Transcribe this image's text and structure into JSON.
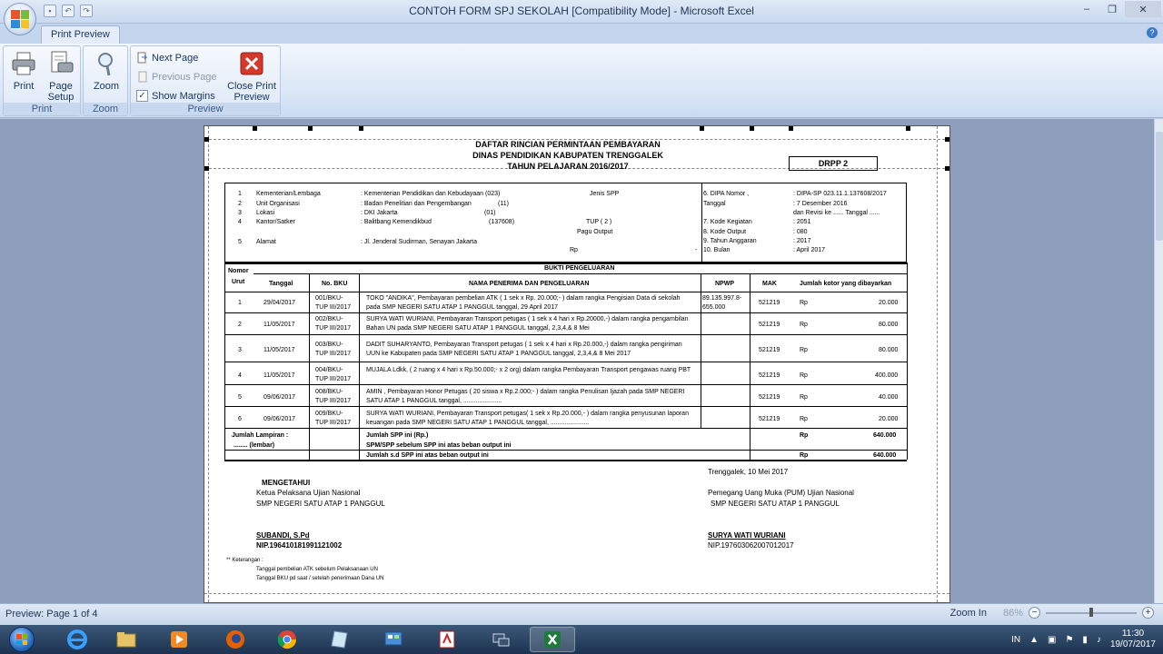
{
  "window": {
    "title": "CONTOH FORM SPJ SEKOLAH  [Compatibility Mode] - Microsoft Excel",
    "minimize": "–",
    "restore": "❐",
    "close": "✕"
  },
  "ribbon": {
    "active_tab": "Print Preview",
    "help": "?",
    "groups": {
      "print": {
        "label": "Print",
        "print_button": "Print",
        "page_setup_button_l1": "Page",
        "page_setup_button_l2": "Setup"
      },
      "zoom": {
        "label": "Zoom",
        "zoom_button": "Zoom"
      },
      "preview": {
        "label": "Preview",
        "next_page": "Next Page",
        "previous_page": "Previous Page",
        "show_margins": "Show Margins",
        "show_margins_checked": true,
        "close_l1": "Close Print",
        "close_l2": "Preview"
      }
    }
  },
  "document": {
    "title_lines": [
      "DAFTAR RINCIAN PERMINTAAN PEMBAYARAN",
      "DINAS PENDIDIKAN KABUPATEN TRENGGALEK",
      "TAHUN PELAJARAN 2016/2017"
    ],
    "form_code": "DRPP 2",
    "info_left": [
      {
        "no": "1",
        "label": "Kementerian/Lembaga",
        "value": ": Kementerian Pendidikan dan Kebudayaan (023)"
      },
      {
        "no": "2",
        "label": "Unit Organisasi",
        "value": ": Badan Penelitian dan Pengembangan",
        "extra": "(11)"
      },
      {
        "no": "3",
        "label": "Lokasi",
        "value": ": DKI Jakarta",
        "extra": "(01)"
      },
      {
        "no": "4",
        "label": "Kantor/Satker",
        "value": ": Balitbang Kemendikbud",
        "extra": "(137608)"
      },
      {
        "no": "5",
        "label": "Alamat",
        "value": ": Jl. Jenderal Sudirman, Senayan Jakarta"
      }
    ],
    "info_mid": {
      "jenis_spp": "Jenis SPP",
      "tup": "TUP ( 2 )",
      "pagu_output": "Pagu Output",
      "rp": "Rp",
      "dash": "-"
    },
    "info_right": [
      {
        "label": "6. DIPA Nomor ,",
        "value": ": DIPA-SP 023.11.1.137608/2017"
      },
      {
        "label": "   Tanggal",
        "value": ": 7 Desember 2016"
      },
      {
        "label": "",
        "value": "  dan Revisi ke ...... Tanggal ......"
      },
      {
        "label": "7. Kode Kegiatan",
        "value": ": 2051"
      },
      {
        "label": "8. Kode Output",
        "value": ": 080"
      },
      {
        "label": "9. Tahun Anggaran",
        "value": ": 2017"
      },
      {
        "label": "10. Bulan",
        "value": ": April 2017"
      }
    ],
    "table": {
      "section_header": "BUKTI PENGELUARAN",
      "headers": {
        "nomor": "Nomor",
        "urut": "Urut",
        "tanggal": "Tanggal",
        "no_bku": "No. BKU",
        "nama": "NAMA PENERIMA DAN PENGELUARAN",
        "npwp": "NPWP",
        "mak": "MAK",
        "jumlah": "Jumlah kotor yang dibayarkan"
      },
      "rows": [
        {
          "no": "1",
          "tanggal": "29/04/2017",
          "bku1": "001/BKU-",
          "bku2": "TUP III/2017",
          "desc": "TOKO \"ANDIKA\", Pembayaran pembelian ATK ( 1 sek x Rp. 20.000;- ) dalam rangka Pengisian Data di sekolah pada SMP NEGERI SATU ATAP 1 PANGGUL tanggal,  29 April 2017",
          "npwp": "89.135.997.8-655.000",
          "mak": "521219",
          "rp": "Rp",
          "amount": "20.000"
        },
        {
          "no": "2",
          "tanggal": "11/05/2017",
          "bku1": "002/BKU-",
          "bku2": "TUP III/2017",
          "desc": "SURYA WATI WURIANI, Pembayaran Transport petugas ( 1 sek x 4 hari x Rp.20000,-) dalam rangka pengambilan Bahan UN pada SMP NEGERI SATU ATAP 1 PANGGUL tanggal, 2,3,4,& 8 Mei",
          "npwp": "",
          "mak": "521219",
          "rp": "Rp",
          "amount": "80.000"
        },
        {
          "no": "3",
          "tanggal": "11/05/2017",
          "bku1": "003/BKU-",
          "bku2": "TUP III/2017",
          "desc": "DADIT SUHARYANTO, Pembayaran Transport petugas ( 1 sek x 4 hari x Rp.20.000,-) dalam rangka pengiriman UUN ke Kabupaten pada SMP NEGERI SATU ATAP 1 PANGGUL tanggal, 2,3,4,& 8 Mei 2017",
          "npwp": "",
          "mak": "521219",
          "rp": "Rp",
          "amount": "80.000"
        },
        {
          "no": "4",
          "tanggal": "11/05/2017",
          "bku1": "004/BKU-",
          "bku2": "TUP III/2017",
          "desc": "MUJALA Ldkk, ( 2 ruang x 4 hari x Rp.50.000;- x 2 org) dalam rangka Pembayaran Transport pengawas ruang PBT",
          "npwp": "",
          "mak": "521219",
          "rp": "Rp",
          "amount": "400.000"
        },
        {
          "no": "5",
          "tanggal": "09/06/2017",
          "bku1": "008/BKU-",
          "bku2": "TUP III/2017",
          "desc": "AMIN , Pembayaran Honor Petugas ( 20 siswa x Rp.2.000;- ) dalam rangka Penulisan Ijazah pada SMP NEGERI SATU ATAP 1 PANGGUL tanggal, ......................",
          "npwp": "",
          "mak": "521219",
          "rp": "Rp",
          "amount": "40.000"
        },
        {
          "no": "6",
          "tanggal": "09/06/2017",
          "bku1": "009/BKU-",
          "bku2": "TUP III/2017",
          "desc": "SURYA WATI WURIANI, Pembayaran Transport petugas( 1 sek x Rp.20.000,- ) dalam rangka penyusunan laporan keuangan pada SMP NEGERI SATU ATAP 1 PANGGUL tanggal, ......................",
          "npwp": "",
          "mak": "521219",
          "rp": "Rp",
          "amount": "20.000"
        }
      ],
      "footer": {
        "lampiran_l1": "Jumlah Lampiran :",
        "lampiran_l2": "........ (lembar)",
        "jumlah_spp": "Jumlah SPP ini (Rp.)",
        "spm_spp": "SPM/SPP sebelum SPP ini atas beban output ini",
        "jumlah_sd": "Jumlah s.d SPP ini atas beban output ini",
        "rp": "Rp",
        "total1": "640.000",
        "total2": "640.000"
      }
    },
    "signatures": {
      "place_date": "Trenggalek, 10 Mei 2017",
      "mengetahui": "MENGETAHUI",
      "left_role1": "Ketua Pelaksana Ujian Nasional",
      "left_role2": "SMP NEGERI SATU ATAP 1 PANGGUL",
      "left_name": "SUBANDI, S.Pd",
      "left_nip": "NIP.196410181991121002",
      "right_role1": "Pemegang Uang Muka (PUM)  Ujian Nasional",
      "right_role2": "SMP NEGERI SATU ATAP 1 PANGGUL",
      "right_name": "SURYA WATI WURIANI",
      "right_nip": "NIP.197603062007012017"
    },
    "notes": {
      "heading": "** Keterangan :",
      "line1": "Tanggal pembelian ATK sebelum Pelaksanaan UN",
      "line2": "Tanggal BKU pd saat / setelah penerimaan Dana UN"
    }
  },
  "statusbar": {
    "page_info": "Preview: Page 1 of 4",
    "zoom_in": "Zoom In",
    "zoom_level": "86%",
    "minus": "−",
    "plus": "+"
  },
  "taskbar": {
    "language": "IN",
    "time": "11:30",
    "date": "19/07/2017"
  }
}
